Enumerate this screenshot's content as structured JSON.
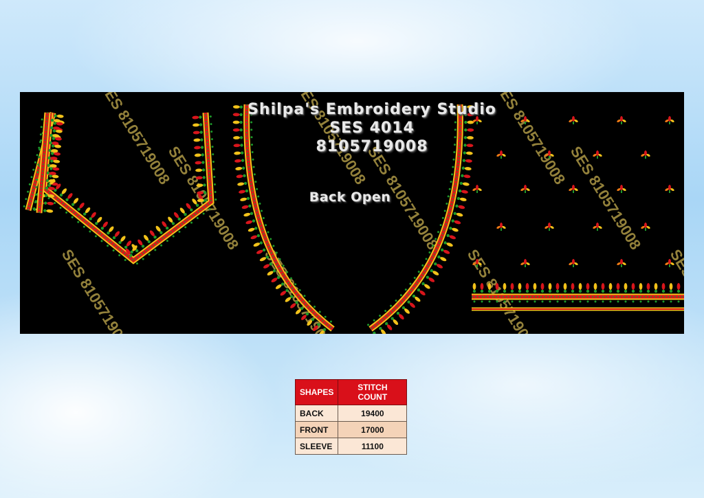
{
  "design": {
    "studio_name": "Shilpa's Embroidery Studio",
    "design_code": "SES 4014",
    "phone": "8105719008",
    "caption": "Back Open",
    "watermark": "SES 8105719008"
  },
  "colors": {
    "panel_background": "#000000",
    "thread_red": "#d8151b",
    "thread_green": "#1f9a2a",
    "thread_yellow": "#f2c21a",
    "thread_orange": "#f07a14",
    "watermark_gold": "#b8a24a",
    "table_header": "#d9101a"
  },
  "stitch_table": {
    "headers": [
      "SHAPES",
      "STITCH COUNT"
    ],
    "rows": [
      [
        "BACK",
        "19400"
      ],
      [
        "FRONT",
        "17000"
      ],
      [
        "SLEEVE",
        "11100"
      ]
    ]
  }
}
